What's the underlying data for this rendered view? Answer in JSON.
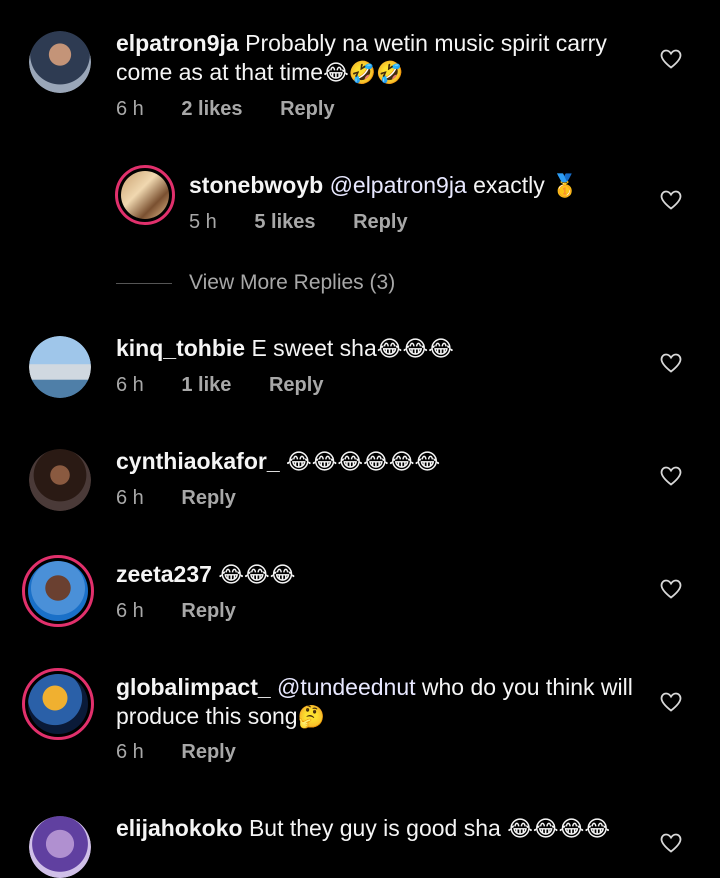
{
  "comments": [
    {
      "user": "elpatron9ja",
      "text": "Probably na wetin music spirit carry come as at that time",
      "emoji": "😂🤣🤣",
      "time": "6 h",
      "likes": "2 likes",
      "reply": "Reply"
    },
    {
      "user": "stonebwoyb",
      "mention": "@elpatron9ja",
      "text": " exactly ",
      "emoji": "🥇",
      "time": "5 h",
      "likes": "5 likes",
      "reply": "Reply"
    },
    {
      "user": "kinq_tohbie",
      "text": "E sweet sha",
      "emoji": "😂😂😂",
      "time": "6 h",
      "likes": "1 like",
      "reply": "Reply"
    },
    {
      "user": "cynthiaokafor_",
      "text": "",
      "emoji": "😂😂😂😂😂😂",
      "time": "6 h",
      "reply": "Reply"
    },
    {
      "user": "zeeta237",
      "text": "",
      "emoji": "😂😂😂",
      "time": "6 h",
      "reply": "Reply"
    },
    {
      "user": "globalimpact_",
      "mention": "@tundeednut",
      "text": " who do you think will produce this song",
      "emoji": "🤔",
      "time": "6 h",
      "reply": "Reply"
    },
    {
      "user": "elijahokoko",
      "text": "But they guy is good sha ",
      "emoji": "😂😂😂😂",
      "time": "",
      "reply": ""
    }
  ],
  "view_more": "View More Replies (3)",
  "icons": {
    "like": "heart-outline-icon"
  }
}
